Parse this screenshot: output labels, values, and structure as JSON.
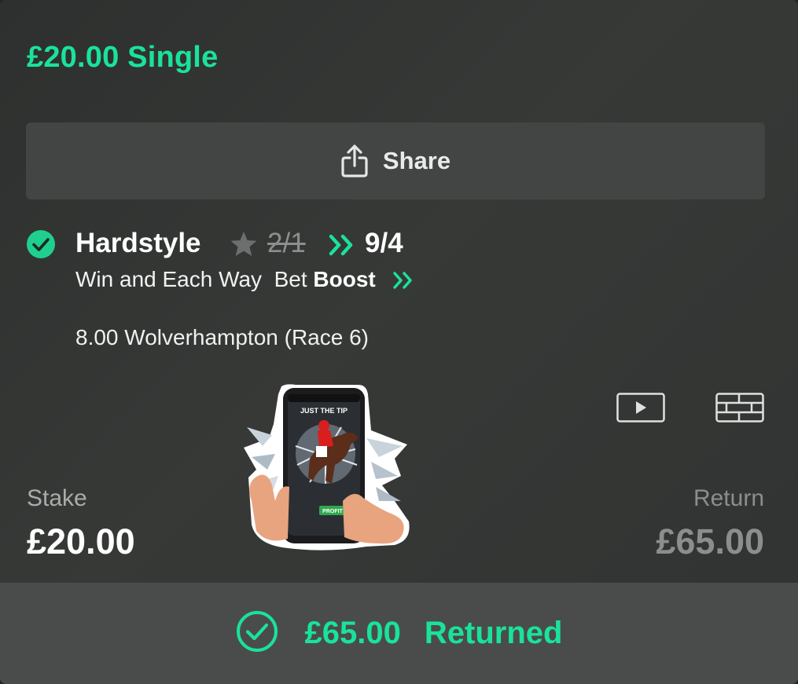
{
  "bet": {
    "title": "£20.00 Single",
    "share_label": "Share"
  },
  "selection": {
    "name": "Hardstyle",
    "old_odds": "2/1",
    "new_odds": "9/4",
    "market_prefix": "Win and Each Way  Bet ",
    "market_boost": "Boost",
    "event": "8.00 Wolverhampton (Race 6)"
  },
  "sticker": {
    "header": "JUST THE TIP",
    "badge": "PROFIT"
  },
  "stake": {
    "label": "Stake",
    "value": "£20.00"
  },
  "return": {
    "label": "Return",
    "value": "£65.00"
  },
  "footer": {
    "amount": "£65.00",
    "status": "Returned"
  },
  "colors": {
    "accent": "#19e39b",
    "background": "#313332",
    "muted": "#8b8e8c"
  },
  "icons": [
    "share-icon",
    "check-circle-icon",
    "star-icon",
    "double-chevron-icon",
    "video-icon",
    "racecard-icon"
  ]
}
